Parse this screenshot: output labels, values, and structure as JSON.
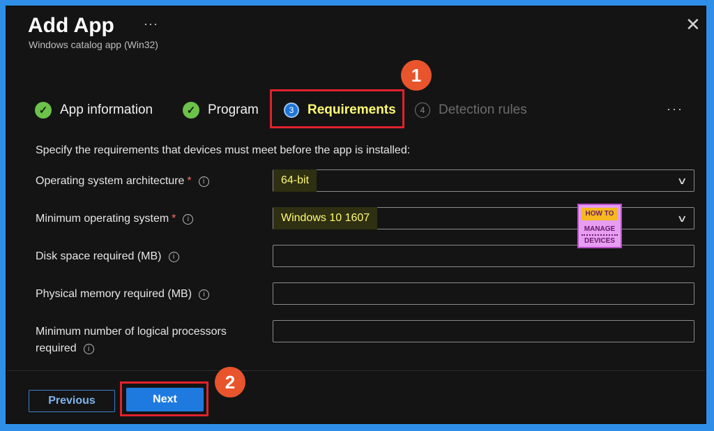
{
  "dialog": {
    "title": "Add App",
    "more": "···",
    "subtitle": "Windows catalog app (Win32)",
    "close": "✕"
  },
  "tabs": [
    {
      "label": "App information",
      "state": "complete",
      "icon": "check-icon"
    },
    {
      "label": "Program",
      "state": "complete",
      "icon": "check-icon"
    },
    {
      "label": "Requirements",
      "state": "active",
      "step": "3"
    },
    {
      "label": "Detection rules",
      "state": "inactive",
      "step": "4"
    }
  ],
  "tabs_more": "···",
  "annotations": {
    "badge1": "1",
    "badge2": "2"
  },
  "intro": "Specify the requirements that devices must meet before the app is installed:",
  "fields": {
    "os_arch": {
      "label": "Operating system architecture",
      "required": "*",
      "value": "64-bit"
    },
    "min_os": {
      "label": "Minimum operating system",
      "required": "*",
      "value": "Windows 10 1607"
    },
    "disk": {
      "label": "Disk space required (MB)",
      "value": ""
    },
    "memory": {
      "label": "Physical memory required (MB)",
      "value": ""
    },
    "processors": {
      "label_line1": "Minimum number of logical processors",
      "label_line2": "required",
      "value": ""
    }
  },
  "logo": {
    "line1": "HOW TO",
    "line2": "MANAGE",
    "line3": "DEVICES"
  },
  "footer": {
    "previous": "Previous",
    "next": "Next"
  },
  "colors": {
    "accent": "#1f7ae0",
    "highlight_text": "#fffb74",
    "annotation_box": "#e0222c",
    "badge": "#e8542b",
    "check": "#6cc24a"
  }
}
